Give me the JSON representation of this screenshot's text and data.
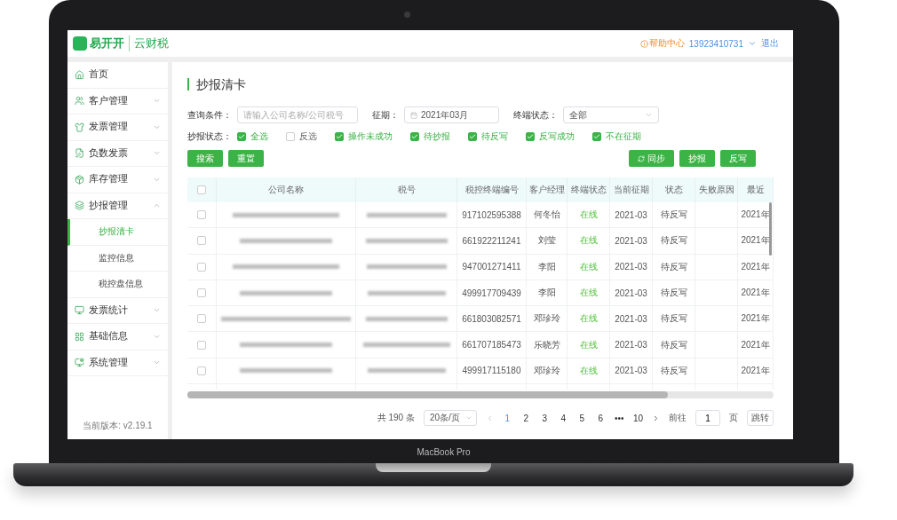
{
  "device": {
    "label": "MacBook Pro"
  },
  "header": {
    "brand": "易开开",
    "product": "云财税",
    "help": "帮助中心",
    "phone": "13923410731",
    "logout": "退出"
  },
  "sidebar": {
    "items": [
      {
        "label": "首页",
        "selected": false
      },
      {
        "label": "客户管理",
        "selected": false,
        "expanded": false
      },
      {
        "label": "发票管理",
        "selected": false,
        "expanded": false
      },
      {
        "label": "负数发票",
        "selected": false,
        "expanded": false
      },
      {
        "label": "库存管理",
        "selected": false,
        "expanded": false
      },
      {
        "label": "抄报管理",
        "selected": false,
        "expanded": true,
        "children": [
          {
            "label": "抄报清卡",
            "selected": true
          },
          {
            "label": "监控信息",
            "selected": false
          },
          {
            "label": "税控盘信息",
            "selected": false
          }
        ]
      },
      {
        "label": "发票统计",
        "selected": false,
        "expanded": false
      },
      {
        "label": "基础信息",
        "selected": false,
        "expanded": false
      },
      {
        "label": "系统管理",
        "selected": false,
        "expanded": false
      }
    ],
    "version": "当前版本: v2.19.1"
  },
  "page": {
    "title": "抄报清卡"
  },
  "filters": {
    "query_label": "查询条件：",
    "query_placeholder": "请输入公司名称/公司税号",
    "period_label": "征期：",
    "period_value": "2021年03月",
    "terminal_label": "终端状态：",
    "terminal_value": "全部",
    "status_label": "抄报状态：",
    "status_options": [
      {
        "label": "全选",
        "checked": true
      },
      {
        "label": "反选",
        "checked": false
      },
      {
        "label": "操作未成功",
        "checked": true
      },
      {
        "label": "待抄报",
        "checked": true
      },
      {
        "label": "待反写",
        "checked": true
      },
      {
        "label": "反写成功",
        "checked": true
      },
      {
        "label": "不在征期",
        "checked": true
      }
    ]
  },
  "left_buttons": [
    {
      "label": "搜索"
    },
    {
      "label": "重置"
    }
  ],
  "right_buttons": [
    {
      "label": "同步"
    },
    {
      "label": "抄报"
    },
    {
      "label": "反写"
    }
  ],
  "table": {
    "header_checked": false,
    "columns": [
      "公司名称",
      "税号",
      "税控终端编号",
      "客户经理",
      "终端状态",
      "当前征期",
      "状态",
      "失败原因",
      "最近"
    ],
    "rows": [
      {
        "selected": false,
        "terminal_no": "917102595388",
        "manager": "何冬怡",
        "terminal_status": "在线",
        "period": "2021-03",
        "status": "待反写",
        "recent": "2021年"
      },
      {
        "selected": false,
        "terminal_no": "661922211241",
        "manager": "刘莹",
        "terminal_status": "在线",
        "period": "2021-03",
        "status": "待反写",
        "recent": "2021年"
      },
      {
        "selected": false,
        "terminal_no": "947001271411",
        "manager": "李阳",
        "terminal_status": "在线",
        "period": "2021-03",
        "status": "待反写",
        "recent": "2021年"
      },
      {
        "selected": false,
        "terminal_no": "499917709439",
        "manager": "李阳",
        "terminal_status": "在线",
        "period": "2021-03",
        "status": "待反写",
        "recent": "2021年"
      },
      {
        "selected": false,
        "terminal_no": "661803082571",
        "manager": "邓珍玲",
        "terminal_status": "在线",
        "period": "2021-03",
        "status": "待反写",
        "recent": "2021年"
      },
      {
        "selected": false,
        "terminal_no": "661707185473",
        "manager": "乐晓芳",
        "terminal_status": "在线",
        "period": "2021-03",
        "status": "待反写",
        "recent": "2021年"
      },
      {
        "selected": false,
        "terminal_no": "499917115180",
        "manager": "邓珍玲",
        "terminal_status": "在线",
        "period": "2021-03",
        "status": "待反写",
        "recent": "2021年"
      }
    ]
  },
  "pagination": {
    "total": "共 190 条",
    "page_size": "20条/页",
    "pages": [
      {
        "label": "1",
        "selected": true
      },
      {
        "label": "2",
        "selected": false
      },
      {
        "label": "3",
        "selected": false
      },
      {
        "label": "4",
        "selected": false
      },
      {
        "label": "5",
        "selected": false
      },
      {
        "label": "6",
        "selected": false
      },
      {
        "label": "•••",
        "selected": false
      },
      {
        "label": "10",
        "selected": false
      }
    ],
    "goto_label": "前往",
    "goto_value": "1",
    "page_unit": "页",
    "jump": "跳转"
  }
}
